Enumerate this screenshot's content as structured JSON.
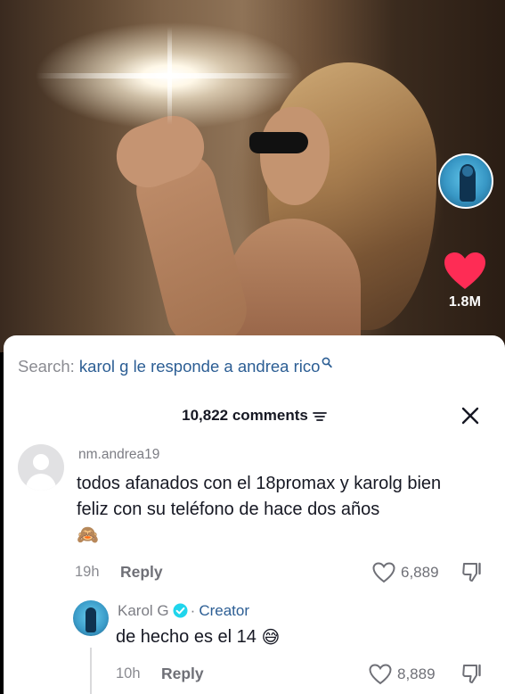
{
  "video": {
    "like_count": "1.8M"
  },
  "search": {
    "label": "Search:",
    "query": "karol g le responde a andrea rico"
  },
  "comments_panel": {
    "count_label": "10,822 comments"
  },
  "comments": [
    {
      "username": "nm.andrea19",
      "text": "todos afanados con el 18promax y karolg bien feliz con su teléfono de hace dos años",
      "emoji": "🙈",
      "time": "19h",
      "reply_label": "Reply",
      "likes": "6,889"
    }
  ],
  "reply": {
    "username": "Karol G",
    "separator": "·",
    "badge": "Creator",
    "text": "de hecho es el 14",
    "emoji": "😅",
    "time": "10h",
    "reply_label": "Reply",
    "likes": "8,889"
  },
  "colors": {
    "like_red": "#fe2c55",
    "link_blue": "#2c5e94",
    "verified_blue": "#20d5ec"
  }
}
